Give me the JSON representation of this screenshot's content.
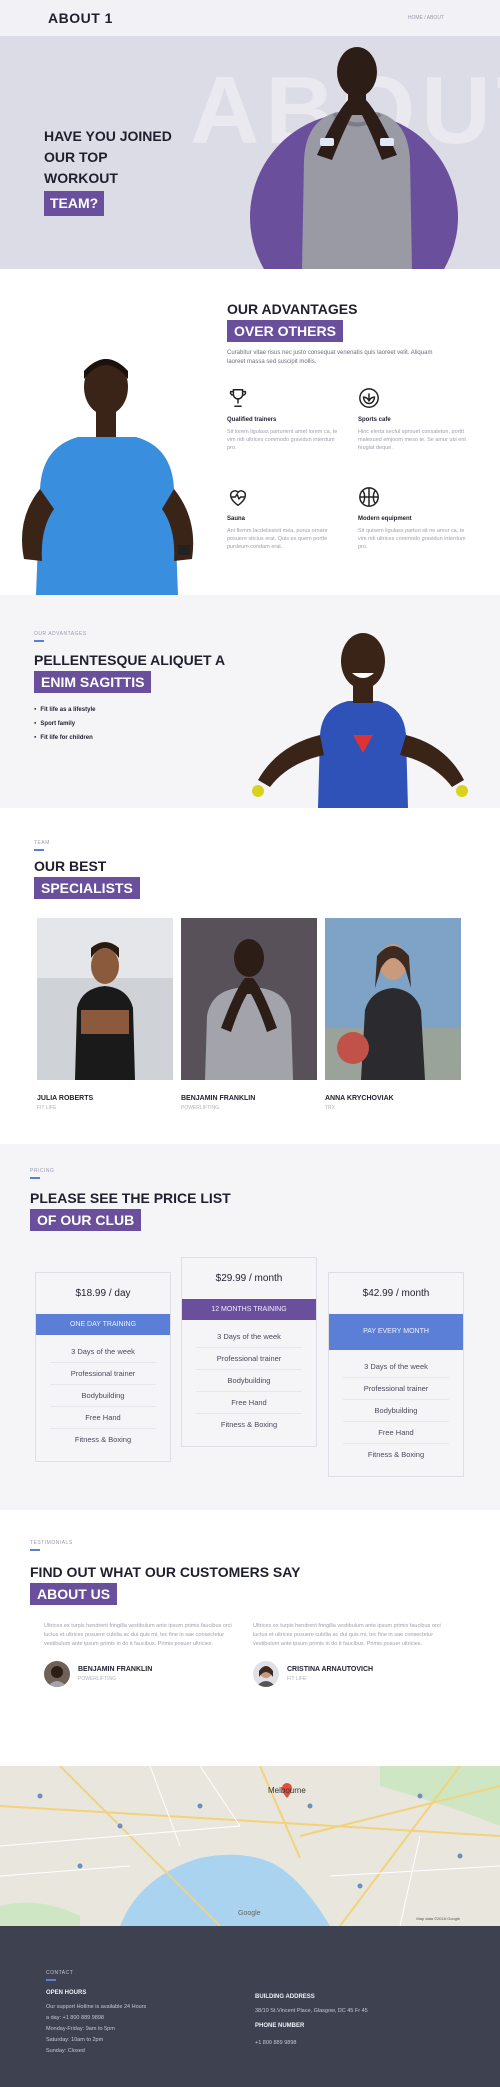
{
  "header": {
    "title": "ABOUT 1",
    "breadcrumb": "HOME / ABOUT"
  },
  "hero": {
    "bg_word": "ABOUT",
    "line1": "HAVE YOU JOINED",
    "line2": "OUR TOP",
    "line3": "WORKOUT",
    "highlight": "TEAM?"
  },
  "advantages": {
    "title": "OUR ADVANTAGES",
    "highlight": "OVER OTHERS",
    "intro": "Curabitur vitae risus nec justo consequat venenatis quis laoreet velit. Aliquam laoreet massa sed suscipit mollis.",
    "items": [
      {
        "icon": "trophy-icon",
        "title": "Qualified trainers",
        "desc": "Sit lorem ligulass parturient amet lorem ca, te vim ridi ultrices commodo gravidun interdum pro."
      },
      {
        "icon": "lotus-icon",
        "title": "Sports cafe",
        "desc": "Hinc elerta secful sprouet consatetun, porttt malesued emjoom meso te. Se amur ubi ent feugiat deque."
      },
      {
        "icon": "heart-pulse-icon",
        "title": "Sauna",
        "desc": "Ani flemm lacdeliesivit mea, purus ornare posuere sitcius erat. Quis ex quem portte purdeum condam erat."
      },
      {
        "icon": "basketball-icon",
        "title": "Modern equipment",
        "desc": "Sit quisem ligulass parturi sit ne amur ca, te vim ridi ultrices commodo gravidun interdum pro."
      }
    ]
  },
  "sagittis": {
    "kicker": "OUR ADVANTAGES",
    "title": "PELLENTESQUE ALIQUET A",
    "highlight": "ENIM SAGITTIS",
    "items": [
      "Fit life as a lifestyle",
      "Sport family",
      "Fit life for children"
    ]
  },
  "specialists": {
    "kicker": "TEAM",
    "title": "OUR BEST",
    "highlight": "SPECIALISTS",
    "members": [
      {
        "name": "JULIA ROBERTS",
        "role": "FIT LIFE"
      },
      {
        "name": "BENJAMIN FRANKLIN",
        "role": "POWERLIFTING"
      },
      {
        "name": "ANNA KRYCHOVIAK",
        "role": "TRX"
      }
    ]
  },
  "pricing": {
    "kicker": "PRICING",
    "title": "PLEASE SEE THE PRICE LIST",
    "highlight": "OF OUR CLUB",
    "accent": "#5b7fd6",
    "featured": "#6a4f9c",
    "plans": [
      {
        "price": "$18.99 / day",
        "button": "ONE DAY TRAINING",
        "features": [
          "3 Days of the week",
          "Professional trainer",
          "Bodybuilding",
          "Free Hand",
          "Fitness & Boxing"
        ]
      },
      {
        "price": "$29.99 / month",
        "button": "12 MONTHS TRAINING",
        "features": [
          "3 Days of the week",
          "Professional trainer",
          "Bodybuilding",
          "Free Hand",
          "Fitness & Boxing"
        ]
      },
      {
        "price": "$42.99 / month",
        "button": "PAY EVERY MONTH",
        "features": [
          "3 Days of the week",
          "Professional trainer",
          "Bodybuilding",
          "Free Hand",
          "Fitness & Boxing"
        ]
      }
    ]
  },
  "testimonials": {
    "kicker": "TESTIMONIALS",
    "title": "FIND OUT WHAT OUR CUSTOMERS SAY",
    "highlight": "ABOUT US",
    "items": [
      {
        "quote": "Ultrices ex turpis hendrerit fringilla vestibulum ante ipsum primis faucibus orci luctus et ultrices posuere cubilia ac dui quis mi, tec fine in sae consectetur vestibulum ante ipsum primis in do it faucibus. Primis posuer ultricies.",
        "name": "BENJAMIN FRANKLIN",
        "role": "POWERLIFTING"
      },
      {
        "quote": "Ultrices ex turpis hendrerit fringilla vestibulum ante ipsum primis faucibus orci luctus et ultrices posuere cubilia ac dui quis mi, tec fine in sae consectetur vestibulum ante ipsum primis in do it faucibus. Primis posuer ultricies.",
        "name": "CRISTINA ARNAUTOVICH",
        "role": "FIT LIFE"
      }
    ]
  },
  "map": {
    "city": "Melbourne",
    "attribution": "Google",
    "data_credit": "Map data ©2018 Google"
  },
  "footer": {
    "kicker": "CONTACT",
    "hours_title": "OPEN HOURS",
    "hours": [
      "Our support Hotline is available 24 Hours",
      "a day: +1 800 889 9898",
      "Monday-Friday: 9am to 5pm",
      "Saturday: 10am to 2pm",
      "Sunday: Closed"
    ],
    "address_title": "BUILDING ADDRESS",
    "address": "38/10 St.Vincent Place, Glasgow, DC 45 Fr 45",
    "phone_title": "PHONE NUMBER",
    "phone": "+1 800 889 9898"
  }
}
